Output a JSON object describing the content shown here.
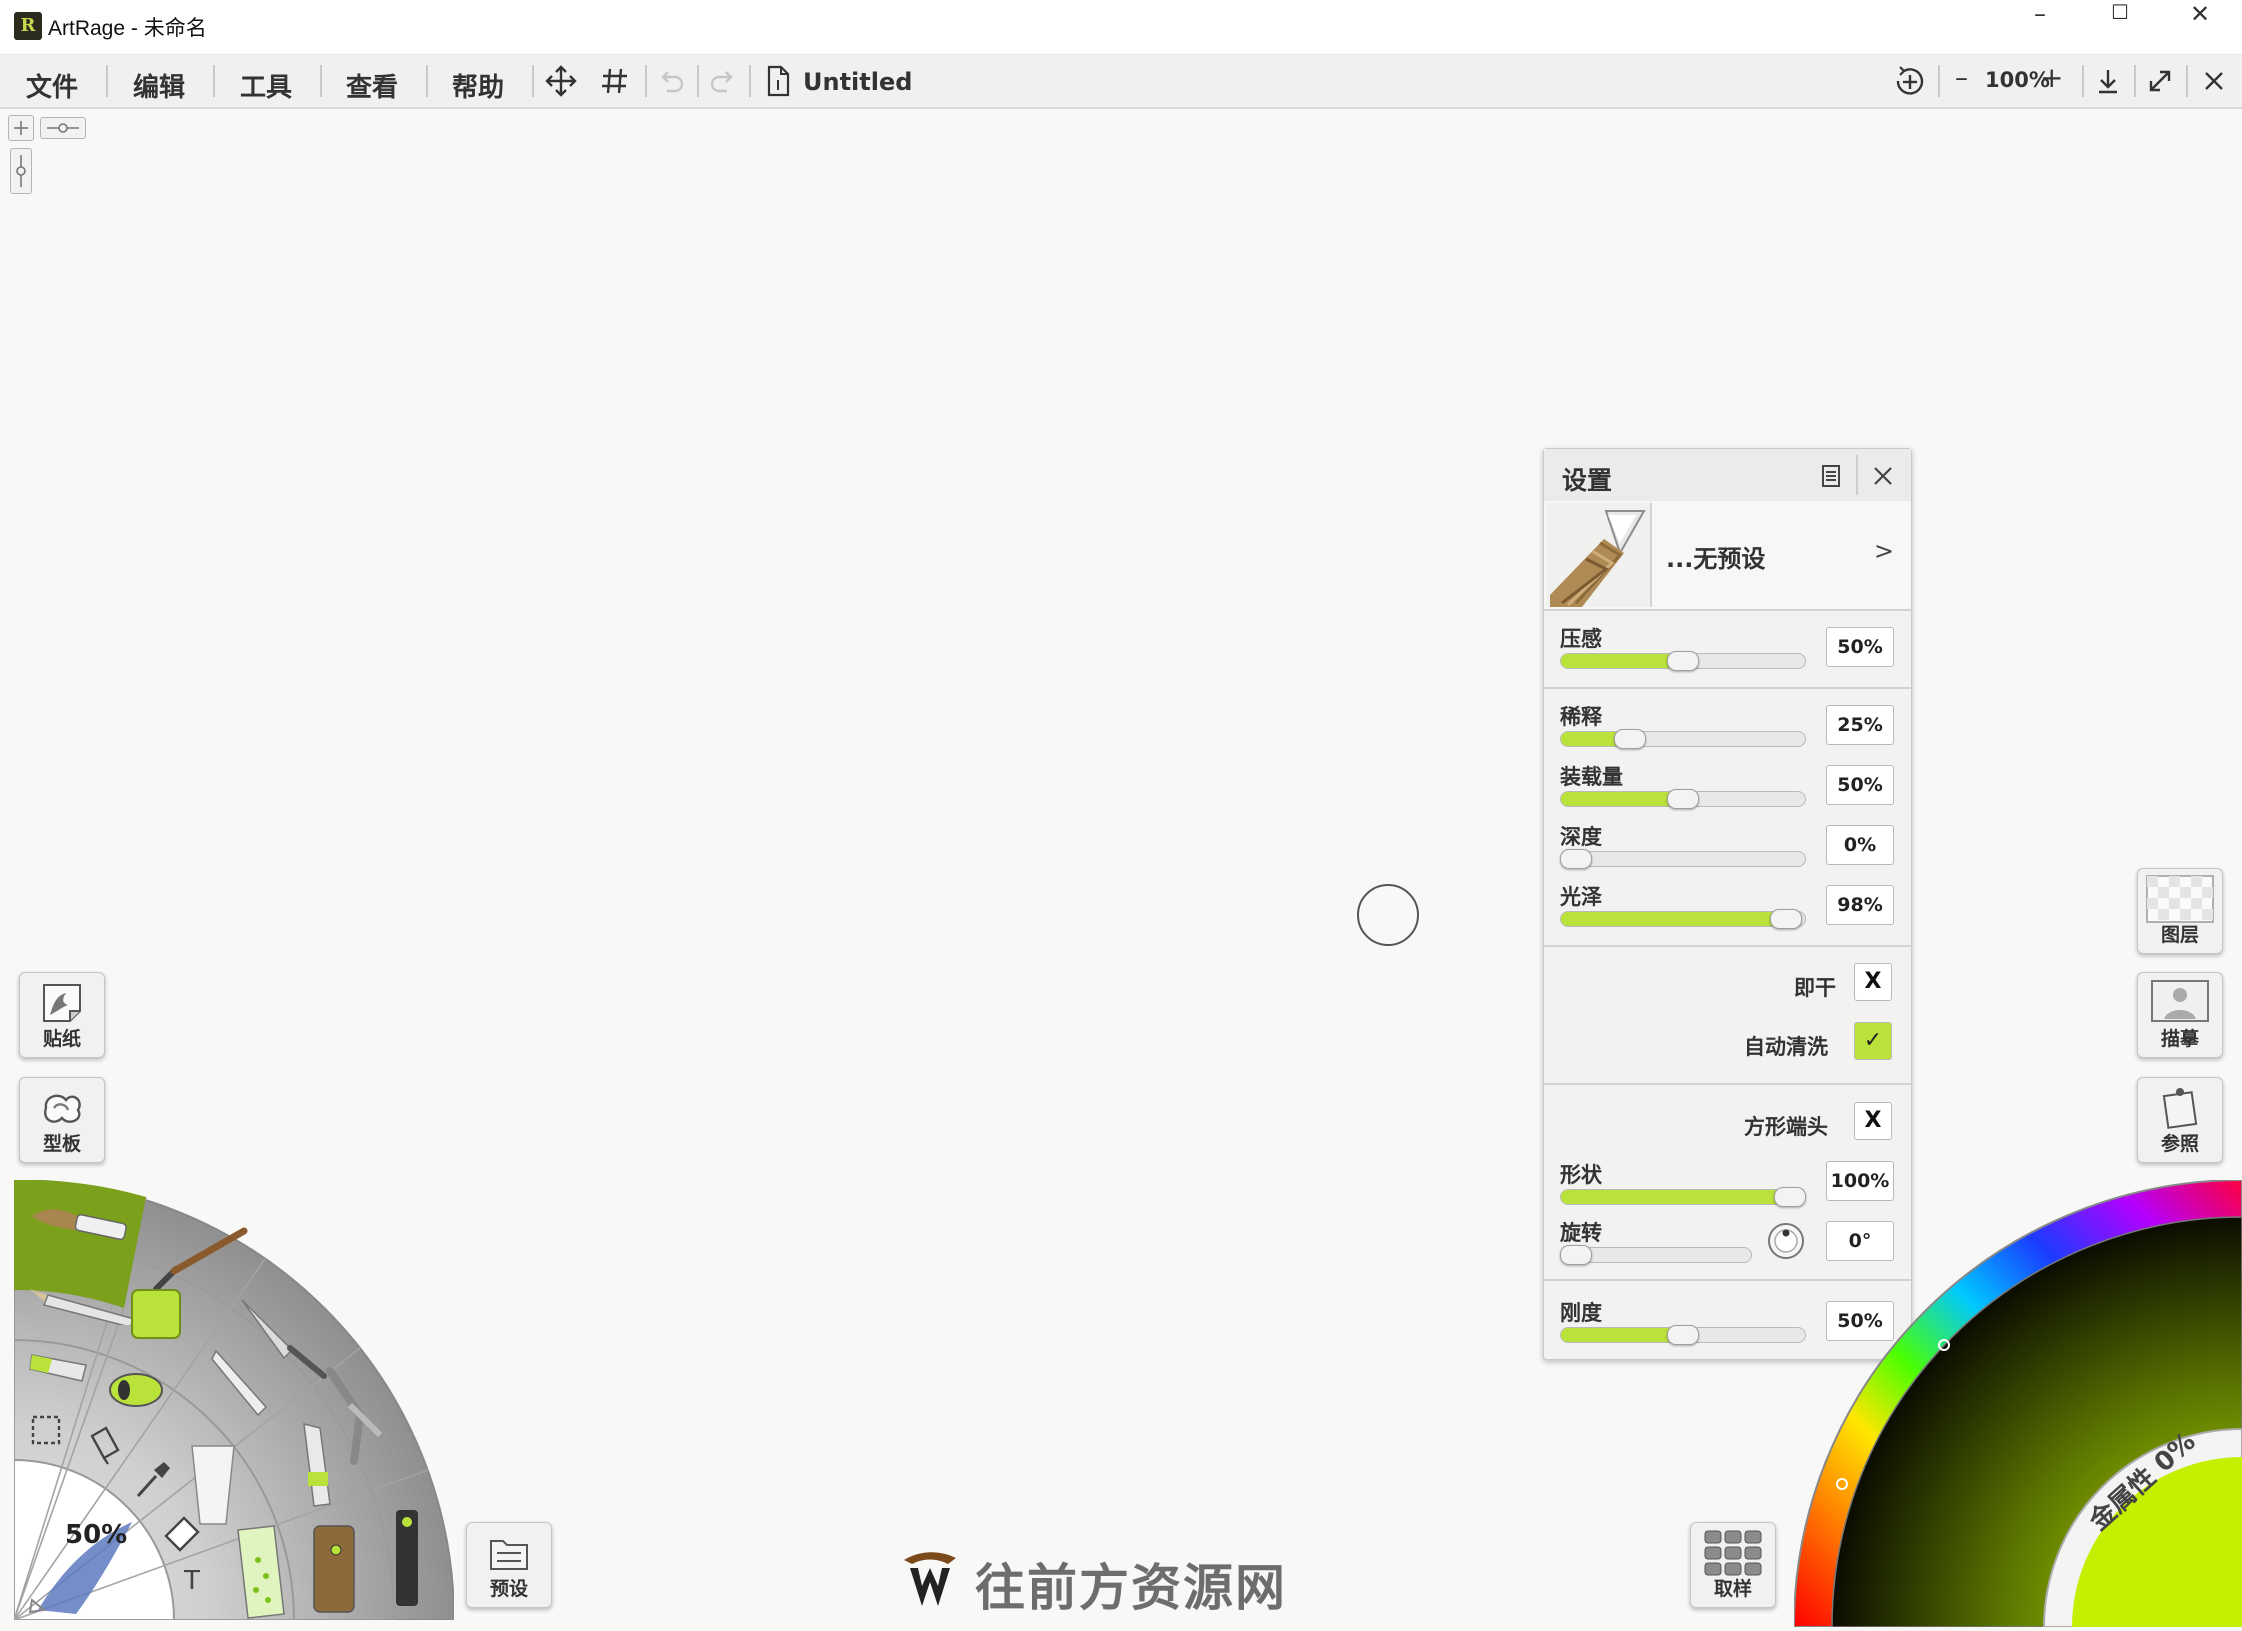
{
  "window": {
    "title": "ArtRage - 未命名",
    "app_icon_glyph": "R",
    "minimize": "–",
    "maximize": "☐",
    "close": "✕"
  },
  "menubar": {
    "menus": [
      "文件",
      "编辑",
      "工具",
      "查看",
      "帮助"
    ],
    "document_title": "Untitled",
    "zoom": {
      "minus": "–",
      "value": "100%",
      "plus": "+"
    }
  },
  "settings_panel": {
    "title": "设置",
    "preset_label": "...无预设",
    "preset_arrow": ">",
    "sliders_top": [
      {
        "label": "压感",
        "value_text": "50%",
        "value": 0.5
      }
    ],
    "sliders_mid": [
      {
        "label": "稀释",
        "value_text": "25%",
        "value": 0.25
      },
      {
        "label": "装载量",
        "value_text": "50%",
        "value": 0.5
      },
      {
        "label": "深度",
        "value_text": "0%",
        "value": 0.0
      },
      {
        "label": "光泽",
        "value_text": "98%",
        "value": 0.98
      }
    ],
    "toggles": [
      {
        "label": "即干",
        "mark": "X",
        "checked": false
      },
      {
        "label": "自动清洗",
        "mark": "✓",
        "checked": true
      }
    ],
    "square_tip": {
      "label": "方形端头",
      "mark": "X",
      "checked": false
    },
    "shape": {
      "label": "形状",
      "value_text": "100%",
      "value": 1.0
    },
    "rotation": {
      "label": "旋转",
      "value_text": "0°",
      "value": 0.0
    },
    "stiffness": {
      "label": "刚度",
      "value_text": "50%",
      "value": 0.5
    }
  },
  "left_buttons": {
    "stickers": "贴纸",
    "stencils": "型板",
    "presets": "预设"
  },
  "right_buttons": {
    "layers": "图层",
    "tracing": "描摹",
    "reference": "参照",
    "sample": "取样"
  },
  "tool_wheel": {
    "size_value": "50%",
    "text_tool": "T"
  },
  "color_picker": {
    "metallic_label": "金属性 0%",
    "current_color": "#c4f000"
  },
  "watermark": {
    "text": "往前方资源网"
  },
  "colors": {
    "accent": "#b9e23b",
    "tool_selected": "#7aa01c",
    "panel_bg": "#f2f2f1"
  }
}
